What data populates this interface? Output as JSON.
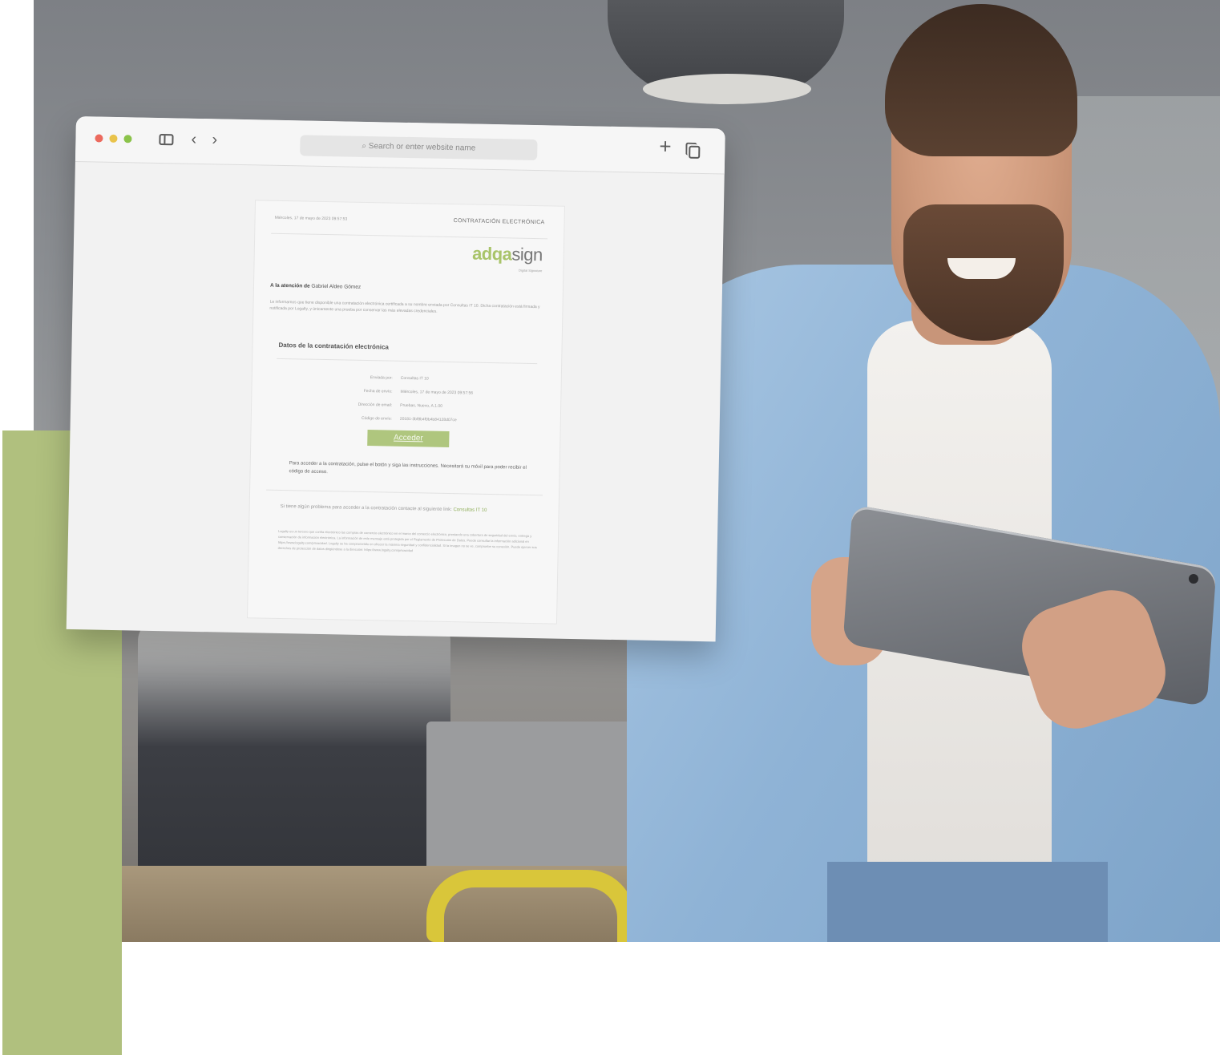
{
  "browser": {
    "address_placeholder": "Search or enter website name",
    "icons": [
      "sidebar-toggle-icon",
      "back-icon",
      "forward-icon",
      "new-tab-icon",
      "tabs-overview-icon"
    ]
  },
  "email": {
    "date_line": "Miércoles, 17 de mayo de 2023 09:57:53",
    "heading": "CONTRATACIÓN ELECTRÓNICA",
    "logo_accent": "adqa",
    "logo_rest": "sign",
    "logo_sub": "Digital Signature",
    "attention_label": "A la atención de",
    "attention_name": "Gabriel Aldeo Gómez",
    "intro": "Le informamos que tiene disponible una contratación electrónica certificada a su nombre enviada por Consultas IT 10. Dicha contratación está firmada y notificada por Logalty, y únicamente una prueba por conservar las más elevadas credenciales.",
    "section_title": "Datos de la contratación electrónica",
    "fields": [
      {
        "label": "Enviada por:",
        "value": "Consultas IT 10"
      },
      {
        "label": "Fecha de envío:",
        "value": "Miércoles, 17 de mayo de 2023 09:57:56"
      },
      {
        "label": "Dirección de email:",
        "value": "Pruebas, Nuevo, A.1.00"
      },
      {
        "label": "Código de envío:",
        "value": "20181-3bf8b4f0b4b84128d07ce"
      }
    ],
    "button": "Acceder",
    "note": "Para acceder a la contratación, pulse el botón y siga las instrucciones. Necesitará su móvil para poder recibir el código de acceso.",
    "footer_text": "Si tiene algún problema para acceder a la contratación contacte al siguiente link:",
    "footer_link": "Consultas IT 10",
    "legal": "Logalty es un tercero que confía electrónico las compras de comercio electrónico en el marco del comercio electrónico, prestando una cobertura de seguridad del envío, entrega y conservación de información electrónica. La información de este mensaje está protegida por el Reglamento de Protección de Datos. Puede consultar la información adicional en https://www.logalty.com/privacidad. Logalty se ha comprometido en ofrecer la máxima seguridad y confidencialidad. Si la imagen no se ve, compruebe su conexión. Puede ejercer sus derechos de protección de datos dirigiéndose a la dirección: https://www.logalty.com/privacidad"
  },
  "colors": {
    "green_block": "#b0c07e",
    "button": "#afc67e",
    "logo_accent": "#a9c46a"
  }
}
